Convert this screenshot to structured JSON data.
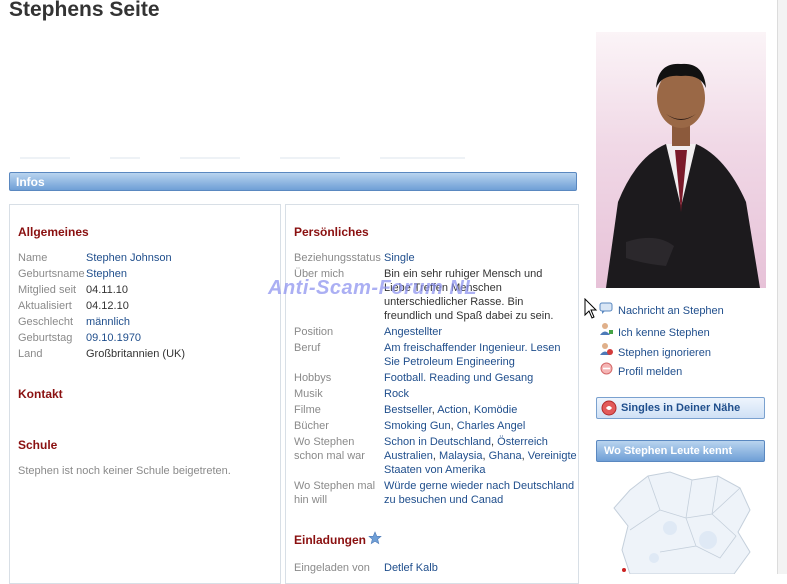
{
  "page": {
    "title": "Stephens Seite"
  },
  "tabs": {
    "infos": "Infos"
  },
  "allgemeines": {
    "heading": "Allgemeines",
    "rows": [
      {
        "label": "Name",
        "value": "Stephen Johnson"
      },
      {
        "label": "Geburtsname",
        "value": "Stephen"
      },
      {
        "label": "Mitglied seit",
        "value": "04.11.10"
      },
      {
        "label": "Aktualisiert",
        "value": "04.12.10"
      },
      {
        "label": "Geschlecht",
        "value": "männlich"
      },
      {
        "label": "Geburtstag",
        "value": "09.10.1970"
      },
      {
        "label": "Land",
        "value": "Großbritannien (UK)"
      }
    ]
  },
  "kontakt": {
    "heading": "Kontakt"
  },
  "schule": {
    "heading": "Schule",
    "text": "Stephen ist noch keiner Schule beigetreten."
  },
  "persoenliches": {
    "heading": "Persönliches",
    "beziehungsstatus": {
      "label": "Beziehungsstatus",
      "value": "Single"
    },
    "ueber_mich": {
      "label": "Über mich",
      "lines": [
        "Bin ein sehr ruhiger Mensch und",
        "Liebe Treffen Menschen",
        "unterschiedlicher Rasse. Bin",
        "freundlich und Spaß dabei zu sein."
      ]
    },
    "position": {
      "label": "Position",
      "value": "Angestellter"
    },
    "beruf": {
      "label": "Beruf",
      "lines": [
        "Am freischaffender Ingenieur. Lesen",
        "Sie Petroleum Engineering"
      ]
    },
    "hobbys": {
      "label": "Hobbys",
      "value": "Football. Reading und Gesang"
    },
    "musik": {
      "label": "Musik",
      "value": "Rock"
    },
    "filme": {
      "label": "Filme",
      "values": [
        "Bestseller",
        "Action",
        "Komödie"
      ]
    },
    "buecher": {
      "label": "Bücher",
      "values": [
        "Smoking Gun",
        "Charles Angel"
      ]
    },
    "wo_war": {
      "label_lines": [
        "Wo Stephen",
        "schon mal war"
      ],
      "values": [
        "Schon in Deutschland",
        "Österreich",
        "Australien",
        "Malaysia",
        "Ghana",
        "Vereinigte",
        "Staaten von Amerika"
      ]
    },
    "wo_will": {
      "label_lines": [
        "Wo Stephen mal",
        "hin will"
      ],
      "lines": [
        "Würde gerne wieder nach Deutschland",
        "zu besuchen und Canad"
      ]
    }
  },
  "einladungen": {
    "heading": "Einladungen",
    "label": "Eingeladen von",
    "value": "Detlef Kalb"
  },
  "actions": [
    {
      "label": "Nachricht an Stephen",
      "icon": "message-icon"
    },
    {
      "label": "Ich kenne Stephen",
      "icon": "user-add-icon"
    },
    {
      "label": "Stephen ignorieren",
      "icon": "user-ignore-icon"
    },
    {
      "label": "Profil melden",
      "icon": "report-icon"
    }
  ],
  "sidebar": {
    "singles_label": "Singles in Deiner Nähe",
    "knows_label": "Wo Stephen Leute kennt"
  },
  "watermark": "Anti-Scam-Forum NL",
  "colors": {
    "heading_red": "#8a1010",
    "link_blue": "#1f4e8c",
    "bar_blue": "#6f9fd6",
    "label_gray": "#8a8a8a"
  }
}
